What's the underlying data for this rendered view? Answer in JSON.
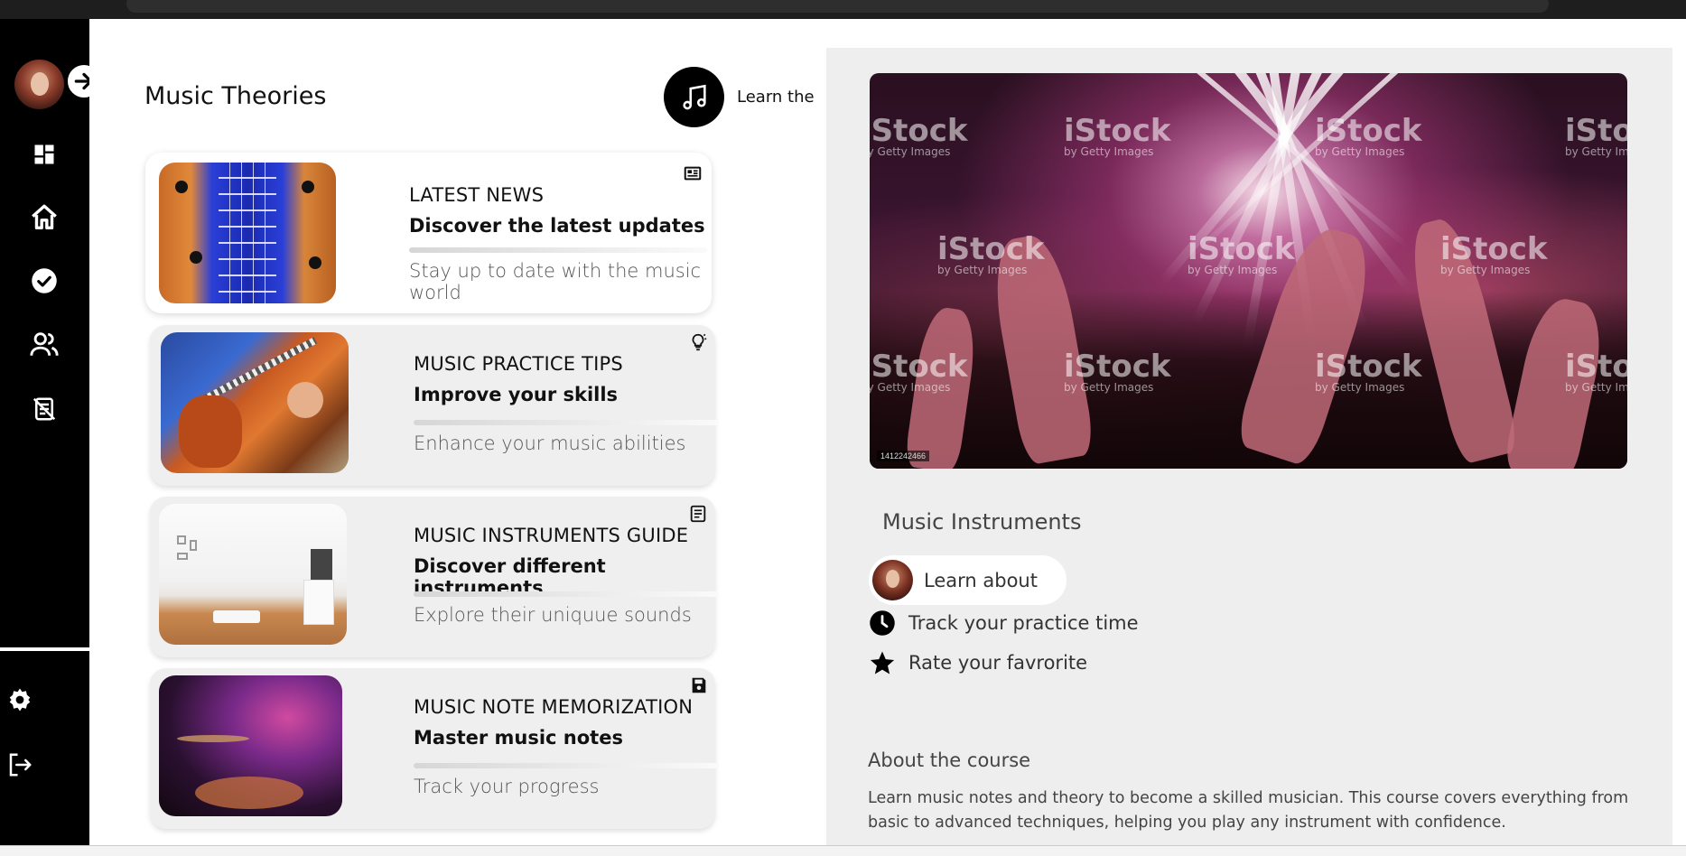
{
  "app": {
    "page_title": "Music Theories",
    "learn_badge_text": "Learn the"
  },
  "cards": [
    {
      "kicker": "LATEST NEWS",
      "heading": "Discover the latest updates",
      "sub": "Stay up to date with the music world",
      "icon": "newspaper-icon"
    },
    {
      "kicker": "MUSIC PRACTICE TIPS",
      "heading": "Improve your skills",
      "sub": "Enhance your music abilities",
      "icon": "lightbulb-icon"
    },
    {
      "kicker": "MUSIC INSTRUMENTS GUIDE",
      "heading": "Discover different instruments",
      "sub": "Explore their uniquue sounds",
      "icon": "document-icon"
    },
    {
      "kicker": "MUSIC NOTE MEMORIZATION",
      "heading": "Master music notes",
      "sub": "Track your progress",
      "icon": "save-icon"
    }
  ],
  "right_panel": {
    "hero_watermark": "iStock",
    "hero_watermark_sub": "by Getty Images",
    "hero_stock_id": "1412242466",
    "title": "Music Instruments",
    "learn_about": "Learn about",
    "features": [
      {
        "label": "Track your practice time",
        "icon": "clock-icon"
      },
      {
        "label": "Rate your fav­rorite",
        "icon": "star-icon"
      }
    ],
    "about_heading": "About the course",
    "about_text": "Learn music notes and theory to become a skilled musician. This course covers everything from basic to advanced techniques, helping you play any instrument with confidence."
  },
  "sidebar": {
    "icons": [
      "dashboard-icon",
      "home-icon",
      "check-circle-icon",
      "users-icon",
      "no-notes-icon"
    ],
    "bottom_icons": [
      "settings-icon",
      "logout-icon"
    ]
  },
  "colors": {
    "sidebar_bg": "#000000",
    "panel_bg": "#eeeeee",
    "card_bg": "#efefef"
  }
}
